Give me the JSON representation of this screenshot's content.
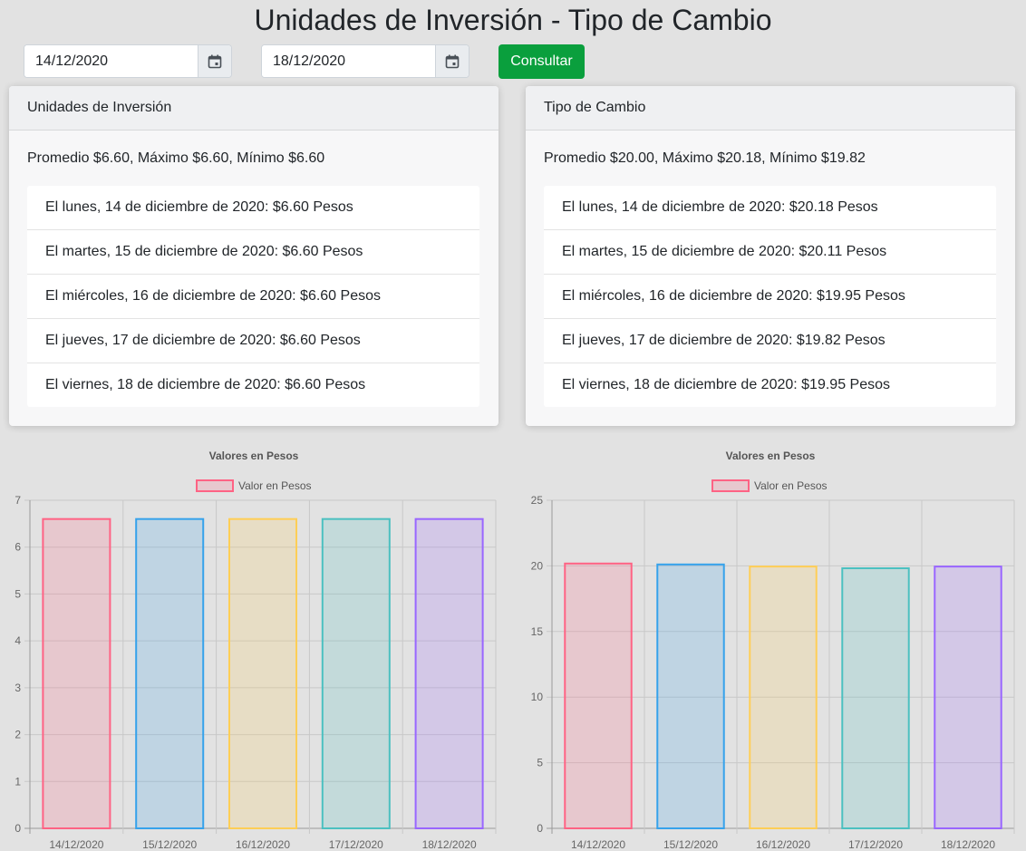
{
  "page": {
    "title": "Unidades de Inversión - Tipo de Cambio"
  },
  "filters": {
    "start_date": "14/12/2020",
    "end_date": "18/12/2020",
    "submit_label": "Consultar",
    "calendar_icon": "calendar-icon"
  },
  "udis_card": {
    "header": "Unidades de Inversión",
    "summary": "Promedio $6.60, Máximo $6.60, Mínimo $6.60",
    "items": [
      "El lunes, 14 de diciembre de 2020: $6.60 Pesos",
      "El martes, 15 de diciembre de 2020: $6.60 Pesos",
      "El miércoles, 16 de diciembre de 2020: $6.60 Pesos",
      "El jueves, 17 de diciembre de 2020: $6.60 Pesos",
      "El viernes, 18 de diciembre de 2020: $6.60 Pesos"
    ]
  },
  "fx_card": {
    "header": "Tipo de Cambio",
    "summary": "Promedio $20.00, Máximo $20.18, Mínimo $19.82",
    "items": [
      "El lunes, 14 de diciembre de 2020: $20.18 Pesos",
      "El martes, 15 de diciembre de 2020: $20.11 Pesos",
      "El miércoles, 16 de diciembre de 2020: $19.95 Pesos",
      "El jueves, 17 de diciembre de 2020: $19.82 Pesos",
      "El viernes, 18 de diciembre de 2020: $19.95 Pesos"
    ]
  },
  "colors": {
    "accent_button": "#0a9f3d",
    "bar_borders": [
      "#ff6384",
      "#36a2eb",
      "#ffce56",
      "#4bc0c0",
      "#9966ff"
    ],
    "bar_fills": [
      "rgba(255,99,132,0.2)",
      "rgba(54,162,235,0.2)",
      "rgba(255,206,86,0.2)",
      "rgba(75,192,192,0.2)",
      "rgba(153,102,255,0.2)"
    ]
  },
  "chart_data": [
    {
      "type": "bar",
      "title": "Valores en Pesos",
      "legend": "Valor en Pesos",
      "legend_position": "top",
      "categories": [
        "14/12/2020",
        "15/12/2020",
        "16/12/2020",
        "17/12/2020",
        "18/12/2020"
      ],
      "series": [
        {
          "name": "Valor en Pesos",
          "values": [
            6.6,
            6.6,
            6.6,
            6.6,
            6.6
          ]
        }
      ],
      "ylim": [
        0,
        7
      ],
      "yticks": [
        0,
        1,
        2,
        3,
        4,
        5,
        6,
        7
      ],
      "grid": true
    },
    {
      "type": "bar",
      "title": "Valores en Pesos",
      "legend": "Valor en Pesos",
      "legend_position": "top",
      "categories": [
        "14/12/2020",
        "15/12/2020",
        "16/12/2020",
        "17/12/2020",
        "18/12/2020"
      ],
      "series": [
        {
          "name": "Valor en Pesos",
          "values": [
            20.18,
            20.11,
            19.95,
            19.82,
            19.95
          ]
        }
      ],
      "ylim": [
        0,
        25
      ],
      "yticks": [
        0,
        5,
        10,
        15,
        20,
        25
      ],
      "grid": true
    }
  ]
}
